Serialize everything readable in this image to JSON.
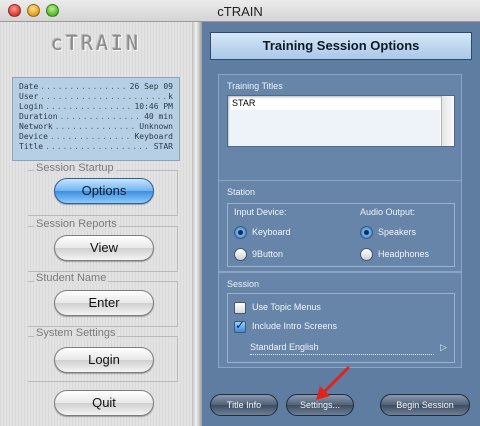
{
  "window": {
    "title": "cTRAIN"
  },
  "sidebar": {
    "logo": "cTRAIN",
    "info": [
      {
        "key": "Date",
        "value": "26 Sep 09"
      },
      {
        "key": "User",
        "value": "k"
      },
      {
        "key": "Login",
        "value": "10:46 PM"
      },
      {
        "key": "Duration",
        "value": "40 min"
      },
      {
        "key": "Network",
        "value": "Unknown"
      },
      {
        "key": "Device",
        "value": "Keyboard"
      },
      {
        "key": "Title",
        "value": "STAR"
      }
    ],
    "sections": [
      {
        "label": "Session Startup",
        "button": "Options"
      },
      {
        "label": "Session Reports",
        "button": "View"
      },
      {
        "label": "Student Name",
        "button": "Enter"
      },
      {
        "label": "System Settings",
        "button": "Login"
      }
    ],
    "quit_label": "Quit"
  },
  "main": {
    "banner": "Training Session Options",
    "training_titles": {
      "label": "Training Titles",
      "items": [
        "STAR"
      ]
    },
    "station": {
      "label": "Station",
      "input_label": "Input Device:",
      "output_label": "Audio Output:",
      "input_options": [
        {
          "label": "Keyboard",
          "selected": true
        },
        {
          "label": "9Button",
          "selected": false
        }
      ],
      "output_options": [
        {
          "label": "Speakers",
          "selected": true
        },
        {
          "label": "Headphones",
          "selected": false
        }
      ]
    },
    "session": {
      "label": "Session",
      "use_topic_menus": {
        "label": "Use Topic Menus",
        "checked": false
      },
      "include_intro": {
        "label": "Include Intro Screens",
        "checked": true
      },
      "language": "Standard English"
    },
    "buttons": {
      "title_info": "Title Info",
      "settings": "Settings...",
      "begin": "Begin Session"
    }
  },
  "colors": {
    "panel": "#5f7da0",
    "primary_button": "#3d8fe0",
    "annotation_arrow": "#e0231b"
  }
}
